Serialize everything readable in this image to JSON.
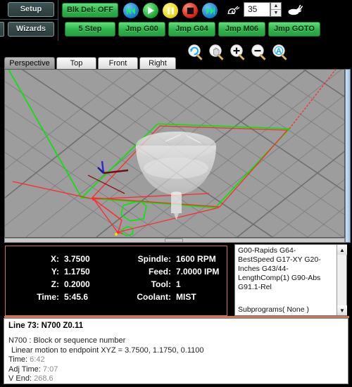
{
  "toolbar": {
    "setup_label": "Setup",
    "wizards_label": "Wizards",
    "blk_del_label": "Blk Del: OFF",
    "step_label": "5 Step",
    "jmp_g00_label": "Jmp G00",
    "jmp_g04_label": "Jmp G04",
    "jmp_m06_label": "Jmp M06",
    "jmp_goto_label": "Jmp GOTO",
    "transport": [
      {
        "name": "rewind-button",
        "glyph": "⏮"
      },
      {
        "name": "play-button",
        "glyph": "▶"
      },
      {
        "name": "pause-button",
        "glyph": "‖"
      },
      {
        "name": "stop-button",
        "glyph": "■"
      },
      {
        "name": "forward-button",
        "glyph": "⏭"
      }
    ],
    "speed_value": "35",
    "speed_slow_icon": "snail-icon",
    "speed_fast_icon": "rabbit-icon",
    "spin_up": "▲",
    "spin_down": "▼"
  },
  "view_tabs": [
    {
      "label": "Perspective",
      "active": true
    },
    {
      "label": "Top",
      "active": false
    },
    {
      "label": "Front",
      "active": false
    },
    {
      "label": "Right",
      "active": false
    }
  ],
  "zoom_tools": [
    {
      "name": "rotate-view-icon",
      "title": "Rotate"
    },
    {
      "name": "pan-view-icon",
      "title": "Pan"
    },
    {
      "name": "zoom-in-icon",
      "title": "Zoom In"
    },
    {
      "name": "zoom-out-icon",
      "title": "Zoom Out"
    },
    {
      "name": "zoom-auto-fit-icon",
      "title": "Auto Fit"
    }
  ],
  "viewport": {
    "background_color": "#9d9d9d",
    "grid_color": "#7a7a7a",
    "toolpath_feed_color": "#00e000",
    "toolpath_rapid_color": "#ff2020",
    "tool_color": "#e8e8e8"
  },
  "dro": {
    "rows": [
      {
        "label": "X:",
        "value": "3.7500",
        "label2": "Spindle:",
        "value2": "1600 RPM"
      },
      {
        "label": "Y:",
        "value": "1.1750",
        "label2": "Feed:",
        "value2": "7.0000 IPM"
      },
      {
        "label": "Z:",
        "value": "0.2000",
        "label2": "Tool:",
        "value2": "1"
      },
      {
        "label": "Time:",
        "value": "5:45.6",
        "label2": "Coolant:",
        "value2": "MIST"
      }
    ],
    "border_color": "#c8755a"
  },
  "modes": {
    "text": "G00-Rapids G64-BestSpeed G17-XY G20-Inches G43/44-LengthComp(1) G90-Abs G91.1-Rel",
    "footer": "Subprograms( None )"
  },
  "status": {
    "header": "Line 73: N700 Z0.11",
    "line1": "N700 : Block or sequence number",
    "line2": "Linear motion to endpoint XYZ = 3.7500, 1.1750, 0.1100",
    "time_label": "Time:",
    "time_value": "6:42",
    "adj_time_label": "Adj Time:",
    "adj_time_value": "7:07",
    "vend_label": "V End:",
    "vend_value": "268.6"
  }
}
